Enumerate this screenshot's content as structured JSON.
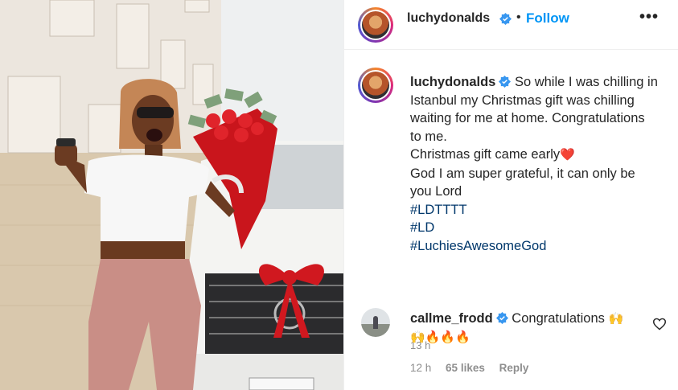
{
  "post": {
    "username": "luchydonalds",
    "separator": "•",
    "follow_label": "Follow",
    "more_label": "•••"
  },
  "caption": {
    "username": "luchydonalds",
    "lines": [
      "So while I was chilling in",
      "Istanbul my Christmas gift was chilling",
      "waiting for me at home. Congratulations",
      "to me.",
      "Christmas gift came early",
      "God I am super grateful, it can only be",
      "you Lord"
    ],
    "heart_emoji": "❤️",
    "hashtags": [
      "#LDTTTT",
      "#LD",
      "#LuchiesAwesomeGod"
    ],
    "time": "13 h"
  },
  "comment": {
    "username": "callme_frodd",
    "text": "Congratulations",
    "emoji_line1": "🙌",
    "emoji_line2": "🙌🔥🔥🔥",
    "time": "12 h",
    "likes": "65 likes",
    "reply_label": "Reply"
  },
  "colors": {
    "follow_blue": "#0095f6",
    "hashtag_blue": "#00376b",
    "verified_blue": "#3897f0",
    "muted_gray": "#8e8e8e"
  },
  "icons": [
    "verified-badge-icon",
    "more-options-icon",
    "heart-icon",
    "red-heart-emoji"
  ]
}
